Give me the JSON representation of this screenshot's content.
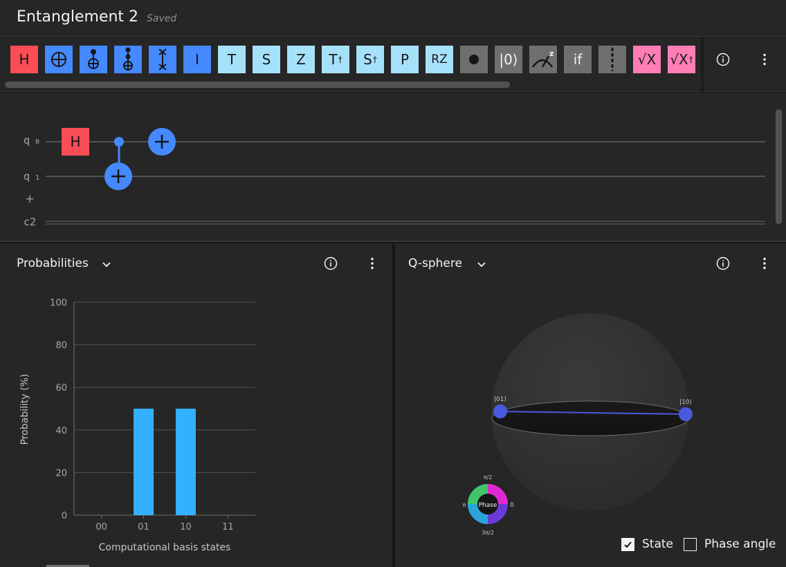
{
  "header": {
    "title": "Entanglement 2",
    "status": "Saved"
  },
  "palette": {
    "gates": [
      {
        "id": "h",
        "label": "H",
        "color": "red"
      },
      {
        "id": "cnot",
        "label": "",
        "icon": "oplus-icon",
        "color": "blue"
      },
      {
        "id": "controlled-not",
        "label": "",
        "icon": "controlled-not-icon",
        "color": "blue"
      },
      {
        "id": "toffoli",
        "label": "",
        "icon": "toffoli-icon",
        "color": "blue"
      },
      {
        "id": "swap",
        "label": "",
        "icon": "swap-icon",
        "color": "blue"
      },
      {
        "id": "i",
        "label": "I",
        "color": "blue"
      },
      {
        "id": "t",
        "label": "T",
        "color": "lightblue"
      },
      {
        "id": "s",
        "label": "S",
        "color": "lightblue"
      },
      {
        "id": "z",
        "label": "Z",
        "color": "lightblue"
      },
      {
        "id": "tdg",
        "label": "T",
        "sup": "†",
        "color": "lightblue"
      },
      {
        "id": "sdg",
        "label": "S",
        "sup": "†",
        "color": "lightblue"
      },
      {
        "id": "p",
        "label": "P",
        "color": "lightblue"
      },
      {
        "id": "rz",
        "label": "RZ",
        "color": "lightblue"
      },
      {
        "id": "barrier-dot",
        "label": "",
        "icon": "dot-icon",
        "color": "gray"
      },
      {
        "id": "reset",
        "label": "|0⟩",
        "color": "gray"
      },
      {
        "id": "measure",
        "label": "",
        "icon": "measure-icon",
        "color": "gray"
      },
      {
        "id": "if",
        "label": "if",
        "color": "gray"
      },
      {
        "id": "barrier",
        "label": "",
        "icon": "barrier-icon",
        "color": "gray"
      },
      {
        "id": "sqrtx",
        "label": "√X",
        "color": "pink"
      },
      {
        "id": "sqrtxdg",
        "label": "√X",
        "sup": "†",
        "color": "pink"
      }
    ]
  },
  "circuit": {
    "wires": [
      {
        "name": "q",
        "index": "0"
      },
      {
        "name": "q",
        "index": "1"
      }
    ],
    "add_wire": "+",
    "classical": "c2",
    "h_gate_label": "H"
  },
  "probabilities": {
    "title": "Probabilities",
    "chart_data": {
      "type": "bar",
      "categories": [
        "00",
        "01",
        "10",
        "11"
      ],
      "values": [
        0,
        50,
        50,
        0
      ],
      "xlabel": "Computational basis states",
      "ylabel": "Probability (%)",
      "ylim": [
        0,
        100
      ],
      "yticks": [
        "0",
        "20",
        "40",
        "60",
        "80",
        "100"
      ],
      "bar_color": "#33b1ff",
      "grid": true
    }
  },
  "qsphere": {
    "title": "Q-sphere",
    "state_labels": [
      "|01⟩",
      "|10⟩"
    ],
    "phase_wheel": {
      "center": "Phase",
      "top": "π/2",
      "left": "π",
      "right": "0",
      "bottom": "3π/2"
    },
    "options": [
      {
        "label": "State",
        "checked": true
      },
      {
        "label": "Phase angle",
        "checked": false
      }
    ]
  },
  "colors": {
    "accent": "#4589ff",
    "bar": "#33b1ff",
    "h_gate": "#fa4d56"
  }
}
